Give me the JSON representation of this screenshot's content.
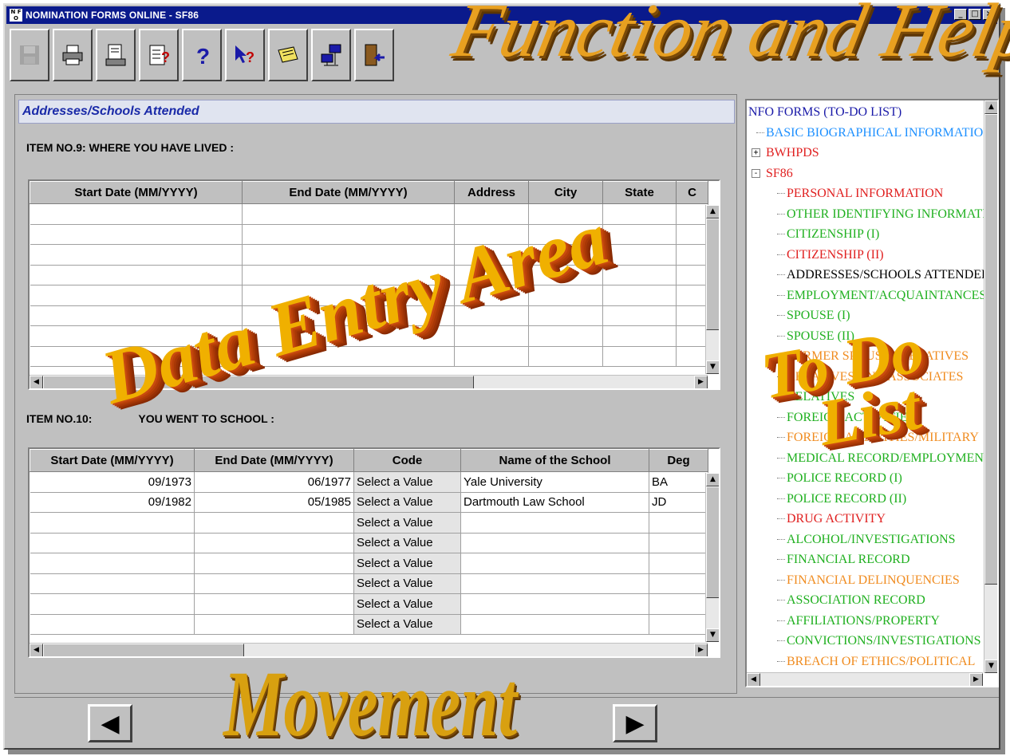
{
  "window": {
    "title": "NOMINATION FORMS ONLINE - SF86",
    "app_icon_text": "N F O",
    "controls": [
      "_",
      "□",
      "×"
    ]
  },
  "toolbar": {
    "buttons": [
      {
        "name": "save",
        "icon": "floppy-disk-icon",
        "enabled": false
      },
      {
        "name": "print",
        "icon": "printer-icon",
        "enabled": true
      },
      {
        "name": "print-preview",
        "icon": "print-preview-icon",
        "enabled": true
      },
      {
        "name": "validate",
        "icon": "document-question-icon",
        "enabled": true
      },
      {
        "name": "help",
        "icon": "question-mark-icon",
        "enabled": true
      },
      {
        "name": "context-help",
        "icon": "pointer-help-icon",
        "enabled": true
      },
      {
        "name": "notes",
        "icon": "notepad-icon",
        "enabled": true
      },
      {
        "name": "network",
        "icon": "network-computers-icon",
        "enabled": true
      },
      {
        "name": "exit",
        "icon": "exit-door-icon",
        "enabled": true
      }
    ]
  },
  "main": {
    "section_title": "Addresses/Schools Attended",
    "item9": {
      "label": "ITEM  NO.9: WHERE YOU HAVE LIVED  :",
      "columns": [
        "Start Date (MM/YYYY)",
        "End Date (MM/YYYY)",
        "Address",
        "City",
        "State",
        "C"
      ],
      "rows": [
        [
          "",
          "",
          "",
          "",
          "",
          ""
        ],
        [
          "",
          "",
          "",
          "",
          "",
          ""
        ],
        [
          "",
          "",
          "",
          "",
          "",
          ""
        ],
        [
          "",
          "",
          "",
          "",
          "",
          ""
        ],
        [
          "",
          "",
          "",
          "",
          "",
          ""
        ],
        [
          "",
          "",
          "",
          "",
          "",
          ""
        ],
        [
          "",
          "",
          "",
          "",
          "",
          ""
        ],
        [
          "",
          "",
          "",
          "",
          "",
          ""
        ]
      ]
    },
    "item10": {
      "label_start": "ITEM  NO.10:",
      "label_end": "YOU WENT TO SCHOOL :",
      "columns": [
        "Start Date (MM/YYYY)",
        "End Date (MM/YYYY)",
        "Code",
        "Name of the School",
        "Deg"
      ],
      "rows": [
        [
          "09/1973",
          "06/1977",
          "Select a Value",
          "Yale University",
          "BA"
        ],
        [
          "09/1982",
          "05/1985",
          "Select a Value",
          "Dartmouth Law School",
          "JD"
        ],
        [
          "",
          "",
          "Select a Value",
          "",
          ""
        ],
        [
          "",
          "",
          "Select a Value",
          "",
          ""
        ],
        [
          "",
          "",
          "Select a Value",
          "",
          ""
        ],
        [
          "",
          "",
          "Select a Value",
          "",
          ""
        ],
        [
          "",
          "",
          "Select a Value",
          "",
          ""
        ],
        [
          "",
          "",
          "Select a Value",
          "",
          ""
        ]
      ]
    }
  },
  "tree": {
    "root": "NFO FORMS (TO-DO LIST)",
    "items": [
      {
        "label": "BASIC BIOGRAPHICAL INFORMATION",
        "level": 1,
        "color": "#1e90ff",
        "expander": ""
      },
      {
        "label": "BWHPDS",
        "level": 1,
        "color": "#e02020",
        "expander": "+"
      },
      {
        "label": "SF86",
        "level": 1,
        "color": "#e02020",
        "expander": "-"
      },
      {
        "label": "PERSONAL INFORMATION",
        "level": 2,
        "color": "#e02020"
      },
      {
        "label": "OTHER IDENTIFYING INFORMATION",
        "level": 2,
        "color": "#20b020"
      },
      {
        "label": "CITIZENSHIP (I)",
        "level": 2,
        "color": "#20b020"
      },
      {
        "label": "CITIZENSHIP (II)",
        "level": 2,
        "color": "#e02020"
      },
      {
        "label": "ADDRESSES/SCHOOLS ATTENDED",
        "level": 2,
        "color": "#000000"
      },
      {
        "label": "EMPLOYMENT/ACQUAINTANCES",
        "level": 2,
        "color": "#20b020"
      },
      {
        "label": "SPOUSE (I)",
        "level": 2,
        "color": "#20b020"
      },
      {
        "label": "SPOUSE (II)",
        "level": 2,
        "color": "#20b020"
      },
      {
        "label": "FORMER SPOUSES/RELATIVES",
        "level": 2,
        "color": "#f08c20"
      },
      {
        "label": "RELATIVES AND ASSOCIATES",
        "level": 2,
        "color": "#f08c20"
      },
      {
        "label": "RELATIVES",
        "level": 2,
        "color": "#20b020"
      },
      {
        "label": "FOREIGN ACTIVITIES",
        "level": 2,
        "color": "#20b020"
      },
      {
        "label": "FOREIGN ACTIVITIES/MILITARY",
        "level": 2,
        "color": "#f08c20"
      },
      {
        "label": "MEDICAL RECORD/EMPLOYMENT",
        "level": 2,
        "color": "#20b020"
      },
      {
        "label": "POLICE RECORD (I)",
        "level": 2,
        "color": "#20b020"
      },
      {
        "label": "POLICE RECORD (II)",
        "level": 2,
        "color": "#20b020"
      },
      {
        "label": "DRUG ACTIVITY",
        "level": 2,
        "color": "#e02020"
      },
      {
        "label": "ALCOHOL/INVESTIGATIONS",
        "level": 2,
        "color": "#20b020"
      },
      {
        "label": "FINANCIAL RECORD",
        "level": 2,
        "color": "#20b020"
      },
      {
        "label": "FINANCIAL DELINQUENCIES",
        "level": 2,
        "color": "#f08c20"
      },
      {
        "label": "ASSOCIATION RECORD",
        "level": 2,
        "color": "#20b020"
      },
      {
        "label": "AFFILIATIONS/PROPERTY",
        "level": 2,
        "color": "#20b020"
      },
      {
        "label": "CONVICTIONS/INVESTIGATIONS",
        "level": 2,
        "color": "#20b020"
      },
      {
        "label": "BREACH OF ETHICS/POLITICAL",
        "level": 2,
        "color": "#f08c20"
      }
    ]
  },
  "nav": {
    "prev": "◀",
    "next": "▶"
  },
  "callouts": {
    "function_help": "Function and Help",
    "data_entry": "Data Entry Area",
    "todo_line1": "To Do",
    "todo_line2": "List",
    "movement": "Movement"
  }
}
